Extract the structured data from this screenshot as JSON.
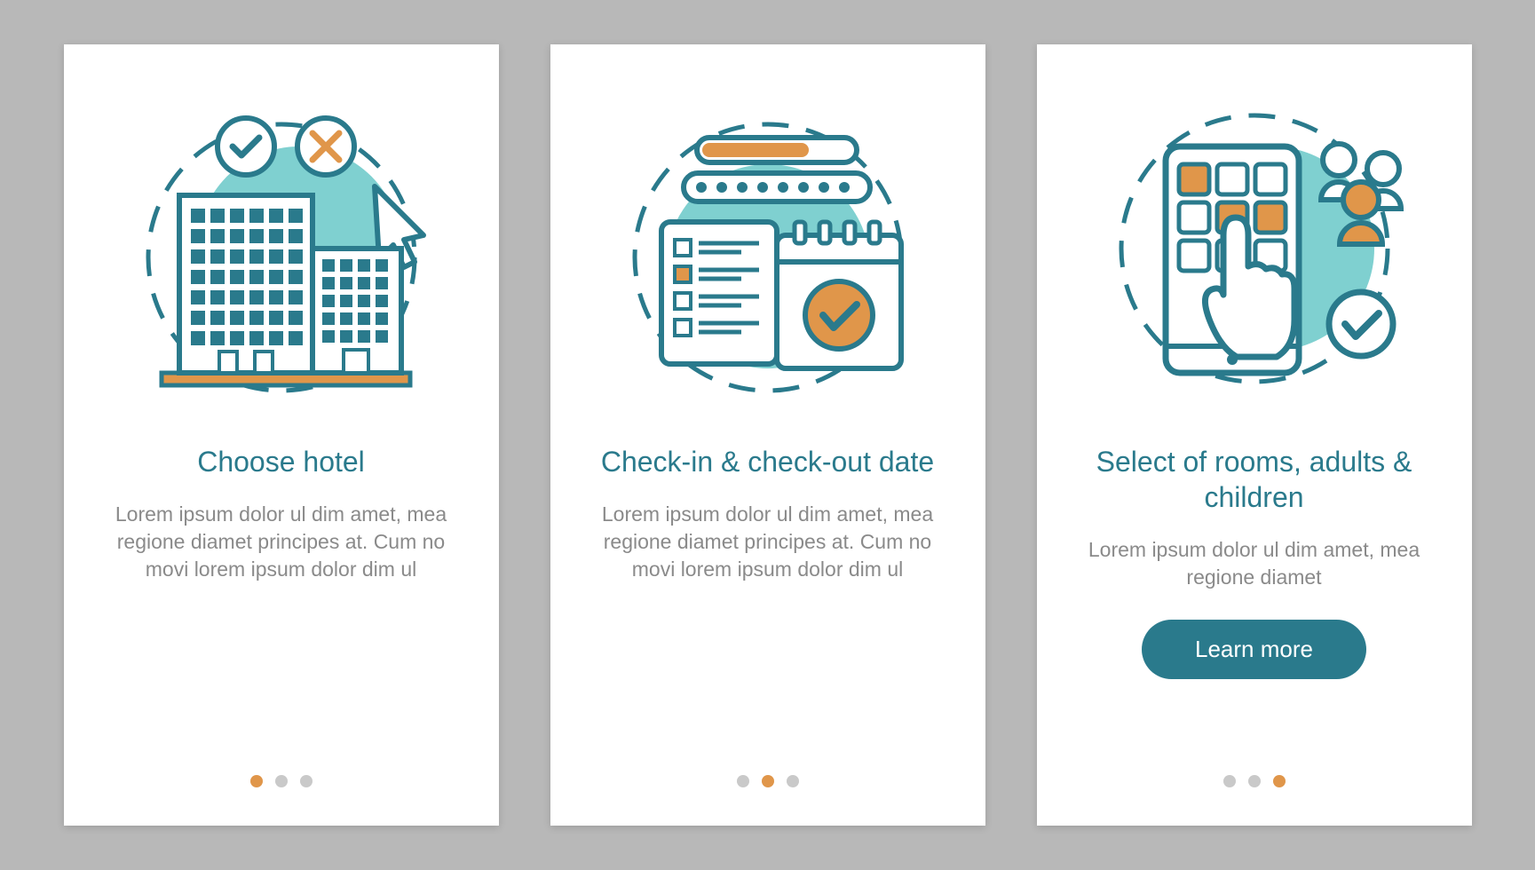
{
  "colors": {
    "teal_dark": "#2a7a8c",
    "teal_light": "#7fd0d0",
    "orange": "#e0964a",
    "gray": "#8a8a8a",
    "dot_inactive": "#c9c9c9"
  },
  "cards": [
    {
      "icon": "hotel-buildings-icon",
      "title": "Choose hotel",
      "body": "Lorem ipsum dolor ul dim amet, mea regione diamet principes at. Cum no movi lorem ipsum dolor dim ul",
      "active_dot": 0,
      "button": null
    },
    {
      "icon": "calendar-checkin-icon",
      "title": "Check-in & check-out date",
      "body": "Lorem ipsum dolor ul dim amet, mea regione diamet principes at. Cum no movi lorem ipsum dolor dim ul",
      "active_dot": 1,
      "button": null
    },
    {
      "icon": "phone-select-icon",
      "title": "Select of rooms, adults & children",
      "body": "Lorem ipsum dolor ul dim amet, mea regione diamet",
      "active_dot": 2,
      "button": "Learn more"
    }
  ]
}
